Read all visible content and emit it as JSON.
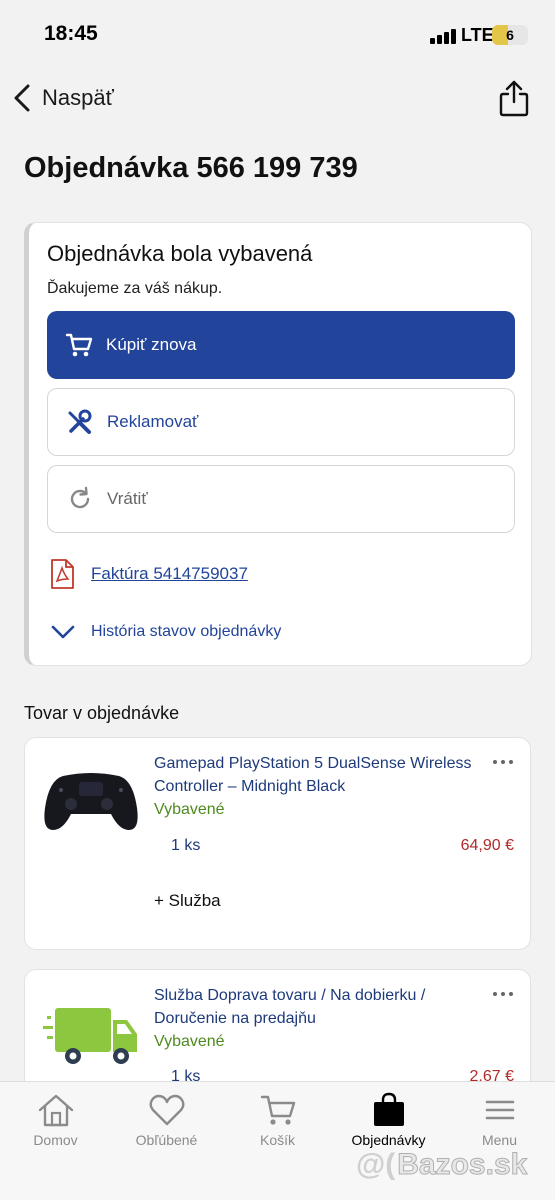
{
  "status_bar": {
    "time": "18:45",
    "network": "LTE",
    "battery": "6"
  },
  "nav": {
    "back_label": "Naspäť",
    "back_icon": "chevron-left-icon",
    "share_icon": "share-icon"
  },
  "page_title": "Objednávka 566 199 739",
  "order_status": {
    "title": "Objednávka bola vybavená",
    "subtitle": "Ďakujeme za váš nákup.",
    "buy_again_label": "Kúpiť znova",
    "claim_label": "Reklamovať",
    "return_label": "Vrátiť",
    "invoice_label": "Faktúra 5414759037",
    "history_label": "História stavov objednávky"
  },
  "section_title": "Tovar v objednávke",
  "items": [
    {
      "name": "Gamepad PlayStation 5 DualSense Wireless Controller – Midnight Black",
      "status": "Vybavené",
      "qty": "1 ks",
      "price": "64,90 €",
      "service": "+ Služba",
      "image_icon": "gamepad-icon"
    },
    {
      "name": "Služba Doprava tovaru / Na dobierku / Doručenie na predajňu",
      "status": "Vybavené",
      "qty": "1 ks",
      "price": "2,67 €",
      "image_icon": "delivery-truck-icon"
    }
  ],
  "tabs": [
    {
      "label": "Domov",
      "icon": "home-icon",
      "active": false
    },
    {
      "label": "Obľúbené",
      "icon": "heart-icon",
      "active": false
    },
    {
      "label": "Košík",
      "icon": "cart-icon",
      "active": false
    },
    {
      "label": "Objednávky",
      "icon": "shopping-bag-icon",
      "active": true
    },
    {
      "label": "Menu",
      "icon": "hamburger-menu-icon",
      "active": false
    }
  ],
  "watermark": {
    "at": "@(",
    "text": "Bazos.sk"
  },
  "colors": {
    "primary": "#22449a",
    "status_green": "#4f8a1e",
    "price_red": "#b02a2a"
  }
}
